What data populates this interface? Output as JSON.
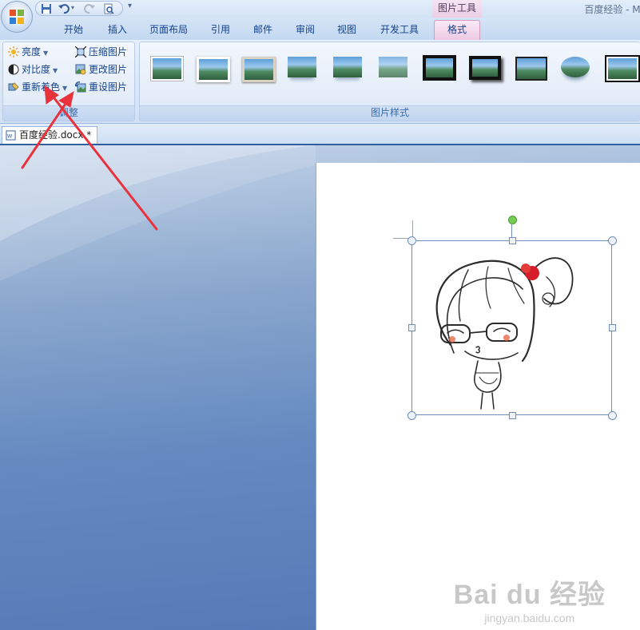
{
  "titlebar": {
    "app_title": "百度经验 - Mi",
    "contextual_tab_header": "图片工具"
  },
  "quick_access": {
    "icons": [
      "save-icon",
      "undo-icon",
      "redo-icon",
      "print-preview-icon"
    ]
  },
  "tabs": [
    {
      "label": "开始"
    },
    {
      "label": "插入"
    },
    {
      "label": "页面布局"
    },
    {
      "label": "引用"
    },
    {
      "label": "邮件"
    },
    {
      "label": "审阅"
    },
    {
      "label": "视图"
    },
    {
      "label": "开发工具"
    },
    {
      "label": "格式"
    }
  ],
  "ribbon": {
    "adjust_group": {
      "label": "调整",
      "buttons": [
        {
          "label": "亮度",
          "icon": "sun-icon",
          "has_dropdown": true
        },
        {
          "label": "对比度",
          "icon": "contrast-icon",
          "has_dropdown": true
        },
        {
          "label": "重新着色",
          "icon": "recolor-icon",
          "has_dropdown": true
        },
        {
          "label": "压缩图片",
          "icon": "compress-icon",
          "has_dropdown": false
        },
        {
          "label": "更改图片",
          "icon": "change-picture-icon",
          "has_dropdown": false
        },
        {
          "label": "重设图片",
          "icon": "reset-picture-icon",
          "has_dropdown": false
        }
      ]
    },
    "styles_group": {
      "label": "图片样式",
      "thumbnail_count": 11
    }
  },
  "document_tab": {
    "label": "百度经验.docx *"
  },
  "watermark": {
    "logo": "Bai du 经验",
    "url": "jingyan.baidu.com"
  },
  "colors": {
    "annotation_arrow": "#e8333d",
    "ribbon_text": "#15428b",
    "selection_handle_top": "#77cc55"
  }
}
